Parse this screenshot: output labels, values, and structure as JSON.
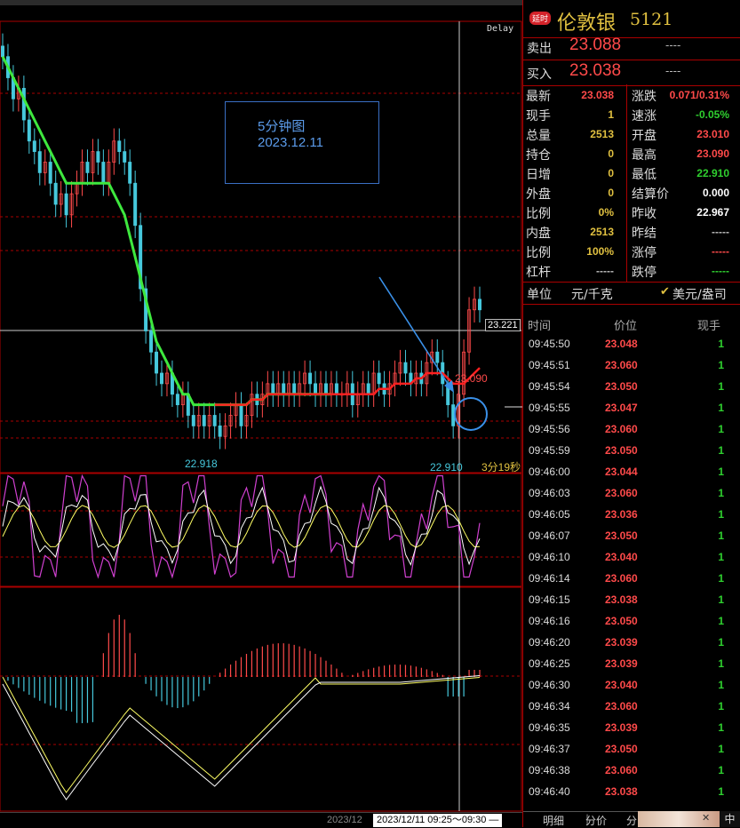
{
  "chart": {
    "delay_label": "Delay",
    "annotation": {
      "line1": "5分钟图",
      "line2": "2023.12.11"
    },
    "price_axis_tag": "23.221",
    "high_label": "23.090",
    "low_label_left": "22.918",
    "low_label_right": "22.910",
    "countdown": "3分19秒",
    "time_prev": "2023/12",
    "time_range": "2023/12/11 09:25～09:30 —",
    "colors": {
      "up": "#ff4a4a",
      "down": "#46c8dc",
      "ma_green": "#3ee83e",
      "ma_red": "#ff2020",
      "k_line": "#ffffff",
      "d_line": "#ffff66",
      "j_line": "#d040d0",
      "annot": "#3a6fc4"
    }
  },
  "chart_data": {
    "type": "line",
    "title": "",
    "ylim": [
      22.9,
      23.3
    ],
    "close": [
      23.28,
      23.26,
      23.24,
      23.25,
      23.22,
      23.2,
      23.19,
      23.17,
      23.18,
      23.16,
      23.14,
      23.15,
      23.13,
      23.15,
      23.16,
      23.18,
      23.17,
      23.19,
      23.18,
      23.16,
      23.18,
      23.2,
      23.19,
      23.18,
      23.16,
      23.12,
      23.06,
      23.02,
      23.0,
      22.98,
      22.97,
      22.98,
      22.96,
      22.95,
      22.96,
      22.94,
      22.93,
      22.94,
      22.93,
      22.94,
      22.93,
      22.92,
      22.93,
      22.94,
      22.95,
      22.93,
      22.94,
      22.96,
      22.95,
      22.96,
      22.97,
      22.96,
      22.97,
      22.96,
      22.97,
      22.96,
      22.97,
      22.98,
      22.97,
      22.96,
      22.97,
      22.96,
      22.97,
      22.96,
      22.96,
      22.97,
      22.95,
      22.96,
      22.97,
      22.96,
      22.98,
      22.97,
      22.96,
      22.97,
      22.98,
      22.99,
      22.98,
      22.97,
      22.98,
      22.97,
      22.99,
      23.0,
      22.99,
      22.97,
      22.95,
      22.93,
      22.96,
      23.0,
      23.04,
      23.05,
      23.04
    ],
    "ma": [
      23.28,
      23.27,
      23.26,
      23.25,
      23.24,
      23.23,
      23.22,
      23.21,
      23.2,
      23.19,
      23.18,
      23.17,
      23.16,
      23.16,
      23.16,
      23.16,
      23.16,
      23.16,
      23.16,
      23.16,
      23.16,
      23.15,
      23.14,
      23.13,
      23.11,
      23.09,
      23.07,
      23.05,
      23.03,
      23.01,
      23.0,
      22.99,
      22.98,
      22.97,
      22.96,
      22.96,
      22.95,
      22.95,
      22.95,
      22.95,
      22.95,
      22.95,
      22.95,
      22.95,
      22.95,
      22.95,
      22.95,
      22.955,
      22.955,
      22.955,
      22.96,
      22.96,
      22.96,
      22.96,
      22.96,
      22.96,
      22.96,
      22.96,
      22.96,
      22.96,
      22.96,
      22.96,
      22.96,
      22.96,
      22.96,
      22.96,
      22.96,
      22.96,
      22.96,
      22.96,
      22.96,
      22.965,
      22.965,
      22.965,
      22.97,
      22.97,
      22.97,
      22.97,
      22.975,
      22.975,
      22.98,
      22.98,
      22.98,
      22.98,
      22.975,
      22.97,
      22.97,
      22.97,
      22.975,
      22.98,
      22.985
    ]
  },
  "header": {
    "badge": "延时",
    "name": "伦敦银",
    "code": "5121"
  },
  "sell": {
    "label": "卖出",
    "price": "23.088",
    "qty": "----"
  },
  "buy": {
    "label": "买入",
    "price": "23.038",
    "qty": "----"
  },
  "quote": {
    "left": [
      {
        "k": "最新",
        "v": "23.038",
        "c": "#ff4a4a"
      },
      {
        "k": "现手",
        "v": "1",
        "c": "#e0c040"
      },
      {
        "k": "总量",
        "v": "2513",
        "c": "#e0c040"
      },
      {
        "k": "持仓",
        "v": "0",
        "c": "#e0c040"
      },
      {
        "k": "日增",
        "v": "0",
        "c": "#e0c040"
      },
      {
        "k": "外盘",
        "v": "0",
        "c": "#e0c040"
      },
      {
        "k": "比例",
        "v": "0%",
        "c": "#e0c040"
      },
      {
        "k": "内盘",
        "v": "2513",
        "c": "#e0c040"
      },
      {
        "k": "比例",
        "v": "100%",
        "c": "#e0c040"
      },
      {
        "k": "杠杆",
        "v": "-----",
        "c": "#bbbbbb"
      }
    ],
    "right": [
      {
        "k": "涨跌",
        "v": "0.071/0.31%",
        "c": "#ff4a4a"
      },
      {
        "k": "速涨",
        "v": "-0.05%",
        "c": "#2fd02f"
      },
      {
        "k": "开盘",
        "v": "23.010",
        "c": "#ff4a4a"
      },
      {
        "k": "最高",
        "v": "23.090",
        "c": "#ff4a4a"
      },
      {
        "k": "最低",
        "v": "22.910",
        "c": "#2fd02f"
      },
      {
        "k": "结算价",
        "v": "0.000",
        "c": "#ffffff"
      },
      {
        "k": "昨收",
        "v": "22.967",
        "c": "#ffffff"
      },
      {
        "k": "昨结",
        "v": "-----",
        "c": "#bbbbbb"
      },
      {
        "k": "涨停",
        "v": "-----",
        "c": "#ff4a4a"
      },
      {
        "k": "跌停",
        "v": "-----",
        "c": "#2fd02f"
      }
    ]
  },
  "unit": {
    "label": "单位",
    "value": "元/千克",
    "check": "✔",
    "alt": "美元/盎司"
  },
  "ticks_header": {
    "time": "时间",
    "price": "价位",
    "vol": "现手"
  },
  "ticks": [
    {
      "t": "09:45:50",
      "p": "23.048",
      "v": "1"
    },
    {
      "t": "09:45:51",
      "p": "23.060",
      "v": "1"
    },
    {
      "t": "09:45:54",
      "p": "23.050",
      "v": "1"
    },
    {
      "t": "09:45:55",
      "p": "23.047",
      "v": "1"
    },
    {
      "t": "09:45:56",
      "p": "23.060",
      "v": "1"
    },
    {
      "t": "09:45:59",
      "p": "23.050",
      "v": "1"
    },
    {
      "t": "09:46:00",
      "p": "23.044",
      "v": "1"
    },
    {
      "t": "09:46:03",
      "p": "23.060",
      "v": "1"
    },
    {
      "t": "09:46:05",
      "p": "23.036",
      "v": "1"
    },
    {
      "t": "09:46:07",
      "p": "23.050",
      "v": "1"
    },
    {
      "t": "09:46:10",
      "p": "23.040",
      "v": "1"
    },
    {
      "t": "09:46:14",
      "p": "23.060",
      "v": "1"
    },
    {
      "t": "09:46:15",
      "p": "23.038",
      "v": "1"
    },
    {
      "t": "09:46:16",
      "p": "23.050",
      "v": "1"
    },
    {
      "t": "09:46:20",
      "p": "23.039",
      "v": "1"
    },
    {
      "t": "09:46:25",
      "p": "23.039",
      "v": "1"
    },
    {
      "t": "09:46:30",
      "p": "23.040",
      "v": "1"
    },
    {
      "t": "09:46:34",
      "p": "23.060",
      "v": "1"
    },
    {
      "t": "09:46:35",
      "p": "23.039",
      "v": "1"
    },
    {
      "t": "09:46:37",
      "p": "23.050",
      "v": "1"
    },
    {
      "t": "09:46:38",
      "p": "23.060",
      "v": "1"
    },
    {
      "t": "09:46:40",
      "p": "23.038",
      "v": "1"
    }
  ],
  "tabs": {
    "t1": "明细",
    "t2": "分价",
    "t3": "分",
    "corner": "中"
  }
}
